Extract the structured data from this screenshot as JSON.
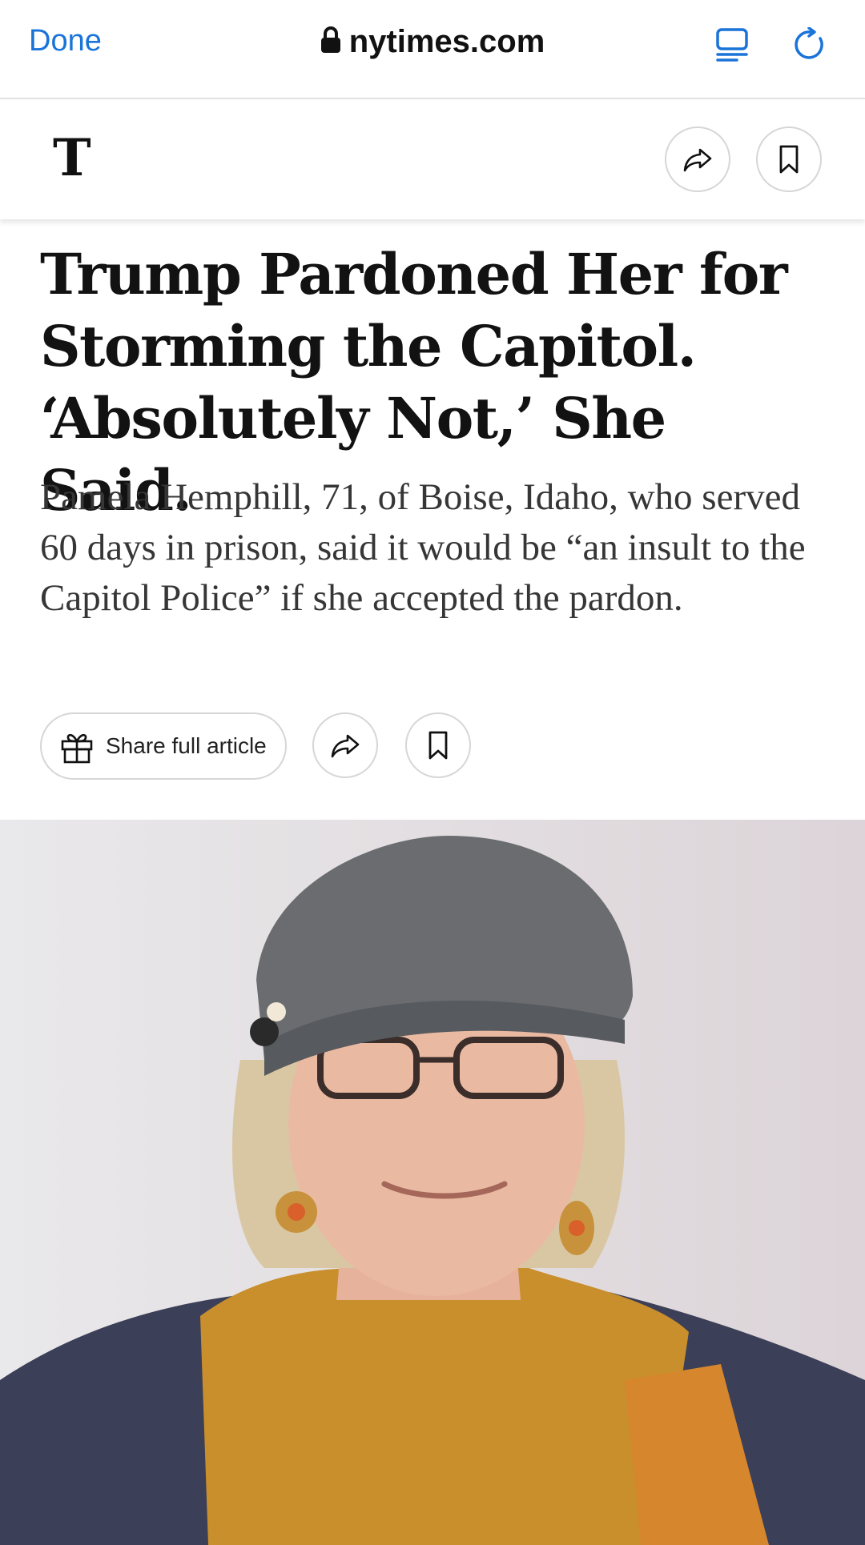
{
  "browser": {
    "done_label": "Done",
    "url": "nytimes.com",
    "icons": [
      "lock-icon",
      "reader-icon",
      "reload-icon"
    ],
    "accent_color": "#1a73d9"
  },
  "app_header": {
    "logo": "T",
    "icons": [
      "share-icon",
      "bookmark-icon"
    ]
  },
  "article": {
    "headline": "Trump Pardoned Her for Storming the Capitol. ‘Absolutely Not,’ She Said.",
    "summary": "Pamela Hemphill, 71, of Boise, Idaho, who served 60 days in prison, said it would be “an insult to the Capitol Police” if she accepted the pardon.",
    "share_full_label": "Share full article",
    "action_icons": [
      "gift-icon",
      "share-icon",
      "bookmark-icon"
    ]
  }
}
